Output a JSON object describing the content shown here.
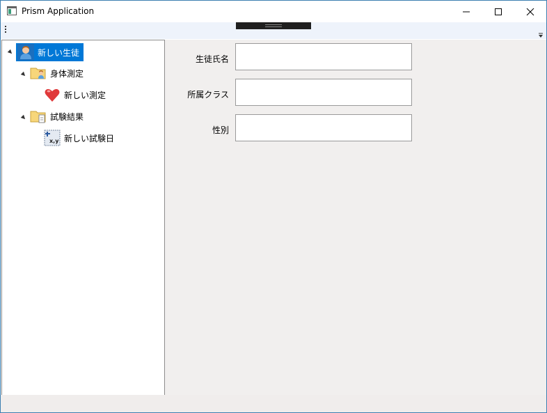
{
  "window": {
    "title": "Prism Application",
    "title_icon": "app-window-icon",
    "controls": [
      "minimize-icon",
      "maximize-icon",
      "close-icon"
    ]
  },
  "tree": {
    "root": {
      "label": "新しい生徒",
      "icon": "student-icon",
      "selected": true
    },
    "groups": [
      {
        "label": "身体測定",
        "icon": "folder-person-icon",
        "expanded": true,
        "children": [
          {
            "label": "新しい測定",
            "icon": "heart-icon"
          }
        ]
      },
      {
        "label": "試験結果",
        "icon": "folder-document-icon",
        "expanded": true,
        "children": [
          {
            "label": "新しい試験日",
            "icon": "xy-plot-icon"
          }
        ]
      }
    ]
  },
  "form": {
    "fields": [
      {
        "label": "生徒氏名",
        "value": ""
      },
      {
        "label": "所属クラス",
        "value": ""
      },
      {
        "label": "性別",
        "value": ""
      }
    ]
  },
  "colors": {
    "selection": "#0078d7",
    "toolbar": "#eef3fb",
    "form_bg": "#f1efee",
    "border": "#3c7fb1"
  }
}
